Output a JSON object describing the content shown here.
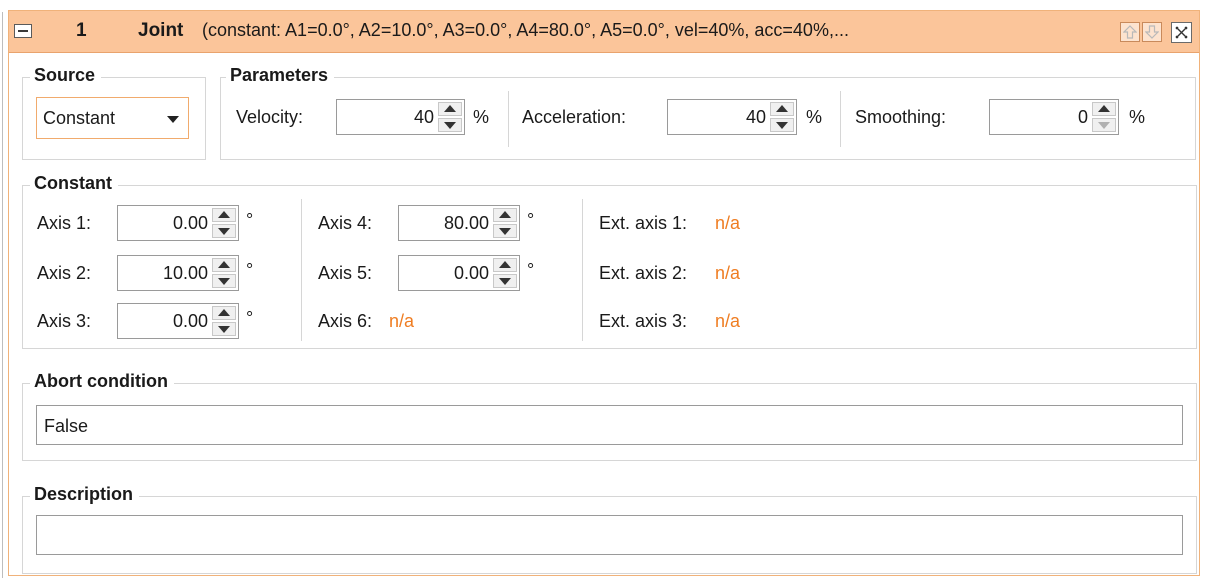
{
  "header": {
    "number": "1",
    "title": "Joint",
    "summary": "(constant: A1=0.0°, A2=10.0°, A3=0.0°, A4=80.0°, A5=0.0°, vel=40%, acc=40%,...",
    "icons": [
      "collapse-icon",
      "move-up-icon",
      "move-down-icon",
      "close-icon"
    ]
  },
  "source": {
    "legend": "Source",
    "selected": "Constant"
  },
  "parameters": {
    "legend": "Parameters",
    "velocity_label": "Velocity:",
    "velocity_value": "40",
    "velocity_unit": "%",
    "acceleration_label": "Acceleration:",
    "acceleration_value": "40",
    "acceleration_unit": "%",
    "smoothing_label": "Smoothing:",
    "smoothing_value": "0",
    "smoothing_unit": "%"
  },
  "constant": {
    "legend": "Constant",
    "axes": [
      {
        "label": "Axis 1:",
        "value": "0.00",
        "unit": "°"
      },
      {
        "label": "Axis 2:",
        "value": "10.00",
        "unit": "°"
      },
      {
        "label": "Axis 3:",
        "value": "0.00",
        "unit": "°"
      },
      {
        "label": "Axis 4:",
        "value": "80.00",
        "unit": "°"
      },
      {
        "label": "Axis 5:",
        "value": "0.00",
        "unit": "°"
      },
      {
        "label": "Axis 6:",
        "value": "n/a"
      }
    ],
    "ext_axes": [
      {
        "label": "Ext. axis 1:",
        "value": "n/a"
      },
      {
        "label": "Ext. axis 2:",
        "value": "n/a"
      },
      {
        "label": "Ext. axis 3:",
        "value": "n/a"
      }
    ]
  },
  "abort": {
    "legend": "Abort condition",
    "value": "False"
  },
  "description": {
    "legend": "Description",
    "value": ""
  },
  "colors": {
    "header_bg": "#fbc59a",
    "accent_orange": "#ef7d22",
    "focus_border": "#f1ab6d"
  }
}
